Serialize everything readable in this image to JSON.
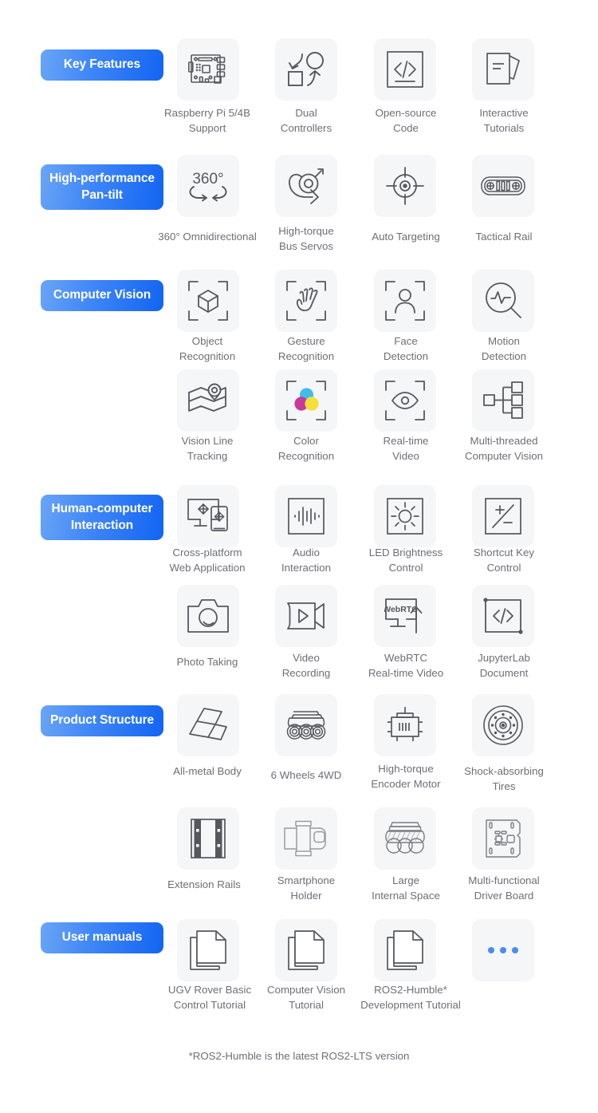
{
  "page": {
    "background": "#ffffff",
    "badge_gradient_from": "#6aa5f6",
    "badge_gradient_to": "#1264f2",
    "tile_background": "#f5f6f7",
    "caption_color": "#6d6f74",
    "dot_color": "#4a8cf0",
    "footnote": "*ROS2-Humble is the latest ROS2-LTS version"
  },
  "sections": [
    {
      "badge": "Key Features",
      "items": [
        {
          "icon": "raspberry-pi-board-icon",
          "label": "Raspberry Pi 5/4B\nSupport"
        },
        {
          "icon": "dual-controllers-icon",
          "label": "Dual\nControllers"
        },
        {
          "icon": "open-source-code-icon",
          "label": "Open-source\nCode"
        },
        {
          "icon": "interactive-tutorials-icon",
          "label": "Interactive\nTutorials"
        }
      ]
    },
    {
      "badge": "High-performance Pan-tilt",
      "items": [
        {
          "icon": "360-omnidirectional-icon",
          "label": "360° Omnidirectional"
        },
        {
          "icon": "high-torque-bus-servo-icon",
          "label": "High-torque\nBus Servos"
        },
        {
          "icon": "auto-targeting-icon",
          "label": "Auto Targeting"
        },
        {
          "icon": "tactical-rail-icon",
          "label": "Tactical Rail"
        }
      ]
    },
    {
      "badge": "Computer Vision",
      "items": [
        {
          "icon": "object-recognition-icon",
          "label": "Object\nRecognition"
        },
        {
          "icon": "gesture-recognition-icon",
          "label": "Gesture\nRecognition"
        },
        {
          "icon": "face-detection-icon",
          "label": "Face\nDetection"
        },
        {
          "icon": "motion-detection-icon",
          "label": "Motion\nDetection"
        },
        {
          "icon": "vision-line-tracking-icon",
          "label": "Vision Line\nTracking"
        },
        {
          "icon": "color-recognition-icon",
          "label": "Color\nRecognition"
        },
        {
          "icon": "real-time-video-icon",
          "label": "Real-time\nVideo"
        },
        {
          "icon": "multi-threaded-computer-vision-icon",
          "label": "Multi-threaded\nComputer Vision"
        }
      ]
    },
    {
      "badge": "Human-computer Interaction",
      "items": [
        {
          "icon": "cross-platform-web-app-icon",
          "label": "Cross-platform\nWeb Application"
        },
        {
          "icon": "audio-interaction-icon",
          "label": "Audio\nInteraction"
        },
        {
          "icon": "led-brightness-control-icon",
          "label": "LED Brightness\nControl"
        },
        {
          "icon": "shortcut-key-control-icon",
          "label": "Shortcut Key\nControl"
        },
        {
          "icon": "photo-taking-icon",
          "label": "Photo Taking"
        },
        {
          "icon": "video-recording-icon",
          "label": "Video\nRecording"
        },
        {
          "icon": "webrtc-real-time-video-icon",
          "label": "WebRTC\nReal-time Video"
        },
        {
          "icon": "jupyterlab-document-icon",
          "label": "JupyterLab\nDocument"
        }
      ]
    },
    {
      "badge": "Product Structure",
      "items": [
        {
          "icon": "all-metal-body-icon",
          "label": "All-metal Body"
        },
        {
          "icon": "six-wheels-4wd-icon",
          "label": "6 Wheels 4WD"
        },
        {
          "icon": "high-torque-encoder-motor-icon",
          "label": "High-torque\nEncoder Motor"
        },
        {
          "icon": "shock-absorbing-tires-icon",
          "label": "Shock-absorbing\nTires"
        },
        {
          "icon": "extension-rails-icon",
          "label": "Extension Rails"
        },
        {
          "icon": "smartphone-holder-icon",
          "label": "Smartphone\nHolder"
        },
        {
          "icon": "large-internal-space-icon",
          "label": "Large\nInternal Space"
        },
        {
          "icon": "multi-functional-driver-board-icon",
          "label": "Multi-functional\nDriver Board"
        }
      ]
    },
    {
      "badge": "User manuals",
      "items": [
        {
          "icon": "document-stack-icon",
          "label": "UGV Rover Basic\nControl Tutorial"
        },
        {
          "icon": "document-stack-icon",
          "label": "Computer Vision\nTutorial"
        },
        {
          "icon": "document-stack-icon",
          "label": "ROS2-Humble*\nDevelopment Tutorial"
        },
        {
          "icon": "more-dots-icon",
          "label": ""
        }
      ]
    }
  ],
  "badges": {
    "key_features": "Key Features",
    "pan_tilt_line1": "High-performance",
    "pan_tilt_line2": "Pan-tilt",
    "computer_vision": "Computer Vision",
    "hci_line1": "Human-computer",
    "hci_line2": "Interaction",
    "product_structure": "Product Structure",
    "user_manuals": "User manuals"
  },
  "captions": {
    "r1c1a": "Raspberry Pi 5/4B",
    "r1c1b": "Support",
    "r1c2a": "Dual",
    "r1c2b": "Controllers",
    "r1c3a": "Open-source",
    "r1c3b": "Code",
    "r1c4a": "Interactive",
    "r1c4b": "Tutorials",
    "r2c1": "360° Omnidirectional",
    "r2c2a": "High-torque",
    "r2c2b": "Bus Servos",
    "r2c3": "Auto Targeting",
    "r2c4": "Tactical Rail",
    "r3c1a": "Object",
    "r3c1b": "Recognition",
    "r3c2a": "Gesture",
    "r3c2b": "Recognition",
    "r3c3a": "Face",
    "r3c3b": "Detection",
    "r3c4a": "Motion",
    "r3c4b": "Detection",
    "r4c1a": "Vision Line",
    "r4c1b": "Tracking",
    "r4c2a": "Color",
    "r4c2b": "Recognition",
    "r4c3a": "Real-time",
    "r4c3b": "Video",
    "r4c4a": "Multi-threaded",
    "r4c4b": "Computer Vision",
    "r5c1a": "Cross-platform",
    "r5c1b": "Web Application",
    "r5c2a": "Audio",
    "r5c2b": "Interaction",
    "r5c3a": "LED Brightness",
    "r5c3b": "Control",
    "r5c4a": "Shortcut Key",
    "r5c4b": "Control",
    "r6c1": "Photo Taking",
    "r6c2a": "Video",
    "r6c2b": "Recording",
    "r6c3a": "WebRTC",
    "r6c3b": "Real-time Video",
    "r6c4a": "JupyterLab",
    "r6c4b": "Document",
    "r7c1": "All-metal Body",
    "r7c2": "6 Wheels 4WD",
    "r7c3a": "High-torque",
    "r7c3b": "Encoder Motor",
    "r7c4a": "Shock-absorbing",
    "r7c4b": "Tires",
    "r8c1": "Extension Rails",
    "r8c2a": "Smartphone",
    "r8c2b": "Holder",
    "r8c3a": "Large",
    "r8c3b": "Internal Space",
    "r8c4a": "Multi-functional",
    "r8c4b": "Driver Board",
    "r9c1a": "UGV Rover Basic",
    "r9c1b": "Control Tutorial",
    "r9c2a": "Computer Vision",
    "r9c2b": "Tutorial",
    "r9c3a": "ROS2-Humble*",
    "r9c3b": "Development Tutorial"
  },
  "icon_labels": {
    "deg360": "360°",
    "webrtc": "WebRTC"
  },
  "footnote": "*ROS2-Humble is the latest ROS2-LTS version"
}
